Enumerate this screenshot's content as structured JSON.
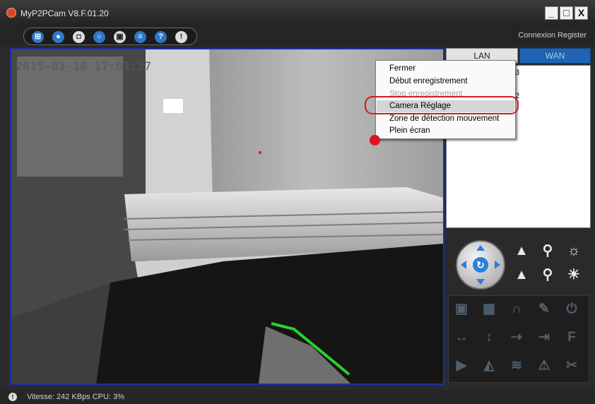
{
  "window": {
    "title": "MyP2PCam  V8.F.01.20"
  },
  "window_buttons": {
    "minimize": "_",
    "maximize": "□",
    "close": "X"
  },
  "toolbar": {
    "icons": [
      "grid-icon",
      "eye-icon",
      "camera-icon",
      "search-icon",
      "lock-icon",
      "book-icon",
      "help-icon",
      "info-icon"
    ],
    "connexion_label": "Connexion Register"
  },
  "video": {
    "timestamp": "2015-03-10 17:01:37"
  },
  "tabs": {
    "lan": "LAN",
    "wan": "WAN"
  },
  "device_list": {
    "stub1": "3",
    "stub2": "2"
  },
  "context_menu": {
    "items": [
      {
        "label": "Fermer"
      },
      {
        "label": "Début enregistrement"
      },
      {
        "label": "Stop enregistrement"
      },
      {
        "label": "Camera Réglage"
      },
      {
        "label": "Zone de détection mouvement"
      },
      {
        "label": "Plein écran"
      }
    ]
  },
  "status": {
    "text": "Vitesse: 242 KBps  CPU:  3%"
  },
  "colors": {
    "highlight_outline": "#d21e1e",
    "accent_blue": "#1f63b2",
    "video_border": "#1c2fa8"
  }
}
